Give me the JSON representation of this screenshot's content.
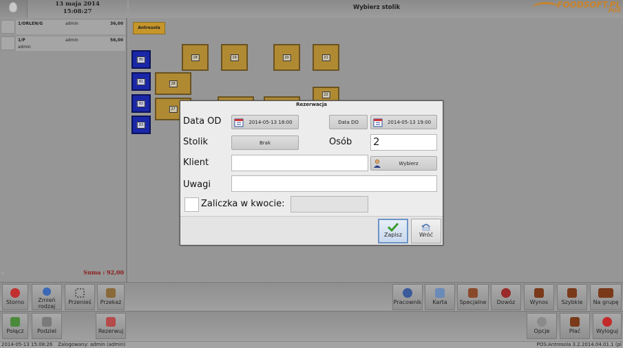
{
  "header": {
    "date": "13 maja 2014",
    "time": "15:08:27",
    "title": "Wybierz stolik",
    "logo": "FOODSOFT.PL",
    "logo_sub": "POS"
  },
  "orders": [
    {
      "name": "1/ORLEN/G",
      "user": "admin",
      "amount": "36,00"
    },
    {
      "name": "1/P",
      "user": "admin",
      "user2": "admin",
      "amount": "56,00"
    }
  ],
  "sum": "Suma : 92,00",
  "room": {
    "tab": "Antresola",
    "tables_blue": [
      "80",
      "81",
      "82",
      "83"
    ],
    "tables": [
      "18",
      "19",
      "20",
      "21",
      "28",
      "27",
      "22"
    ]
  },
  "dialog": {
    "title": "Rezerwacja",
    "data_od_label": "Data OD",
    "data_od_value": "2014-05-13 18:00",
    "data_do_button": "Data DO",
    "data_do_value": "2014-05-13 19:00",
    "stolik_label": "Stolik",
    "stolik_value": "Brak",
    "osob_label": "Osób",
    "osob_value": "2",
    "klient_label": "Klient",
    "klient_value": "",
    "wybierz": "Wybierz",
    "uwagi_label": "Uwagi",
    "uwagi_value": "",
    "zaliczka_label": "Zaliczka w kwocie:",
    "zaliczka_value": "",
    "save": "Zapisz",
    "back": "Wróć"
  },
  "toolbar_left_row1": [
    "Storno",
    "Zmień rodzaj",
    "Przenieś",
    "Przekaż"
  ],
  "toolbar_left_row2": [
    "Połącz",
    "Podziel",
    "Rezerwuj"
  ],
  "toolbar_right_row1": [
    "Pracownik",
    "Karta",
    "Specjalne",
    "Dowóz",
    "Wynos",
    "Szybkie",
    "Na grupę"
  ],
  "toolbar_right_row2": [
    "Opcje",
    "Płać",
    "Wyloguj"
  ],
  "statusbar": {
    "datetime": "2014-05-13 15:08:26",
    "user": "Zalogowany: admin (admin)",
    "right": "POS:Antresola  3.2.2014.04.01.1 (pl"
  },
  "colors": {
    "table_gold": "#b08a33",
    "table_blue": "#1a27a8",
    "sum_red": "#8c1c1c",
    "logo_orange": "#c8832b"
  }
}
